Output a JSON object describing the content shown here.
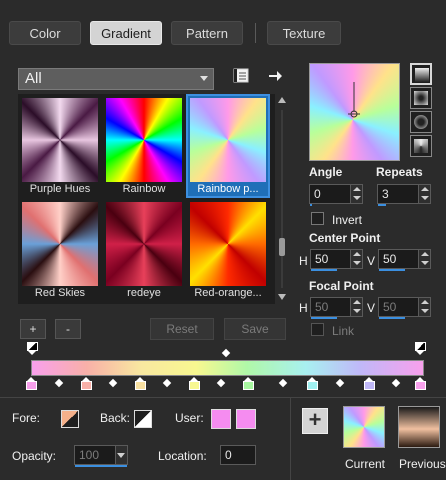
{
  "tabs": [
    {
      "label": "Color",
      "active": false
    },
    {
      "label": "Gradient",
      "active": true
    },
    {
      "label": "Pattern",
      "active": false
    },
    {
      "label": "Texture",
      "active": false
    }
  ],
  "category": {
    "selected": "All"
  },
  "gallery": {
    "items": [
      {
        "label": "Purple Hues",
        "selected": false
      },
      {
        "label": "Rainbow",
        "selected": false
      },
      {
        "label": "Rainbow p...",
        "selected": true
      },
      {
        "label": "Red Skies",
        "selected": false
      },
      {
        "label": "redeye",
        "selected": false
      },
      {
        "label": "Red-orange...",
        "selected": false
      }
    ]
  },
  "actions": {
    "add": "+",
    "remove": "-",
    "reset": "Reset",
    "save": "Save"
  },
  "properties": {
    "angle_label": "Angle",
    "angle_value": "0",
    "repeats_label": "Repeats",
    "repeats_value": "3",
    "invert_label": "Invert",
    "invert_checked": false,
    "center_point_label": "Center Point",
    "center_h_label": "H",
    "center_h_value": "50",
    "center_v_label": "V",
    "center_v_value": "50",
    "focal_point_label": "Focal Point",
    "focal_h_label": "H",
    "focal_h_value": "50",
    "focal_v_label": "V",
    "focal_v_value": "50",
    "link_label": "Link",
    "link_checked": false
  },
  "stop_editor": {
    "fore_label": "Fore:",
    "back_label": "Back:",
    "user_label": "User:",
    "opacity_label": "Opacity:",
    "opacity_value": "100",
    "location_label": "Location:",
    "location_value": "0",
    "user_color": "#f58cf0"
  },
  "swatches": {
    "current_label": "Current",
    "previous_label": "Previous"
  },
  "colors": {
    "accent": "#3b8fe0",
    "background": "#2b2b2b"
  }
}
